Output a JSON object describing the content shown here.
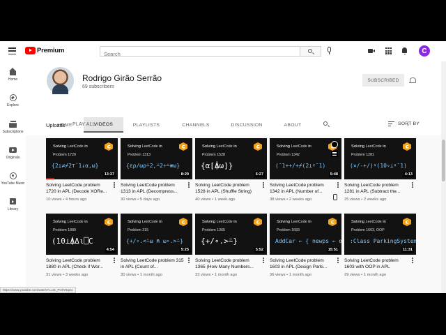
{
  "topbar": {
    "logo_text": "Premium",
    "search_placeholder": "Search",
    "avatar_letter": "C"
  },
  "sidebar": {
    "items": [
      {
        "label": "Home",
        "icon": "home-icon"
      },
      {
        "label": "Explore",
        "icon": "explore-icon"
      },
      {
        "label": "Subscriptions",
        "icon": "subscriptions-icon"
      },
      {
        "label": "Originals",
        "icon": "originals-icon"
      },
      {
        "label": "YouTube Music",
        "icon": "music-icon"
      },
      {
        "label": "Library",
        "icon": "library-icon"
      }
    ]
  },
  "channel": {
    "name": "Rodrigo Girão Serrão",
    "subscribers": "69 subscribers",
    "subscribe_label": "SUBSCRIBED",
    "tabs": [
      "HOME",
      "VIDEOS",
      "PLAYLISTS",
      "CHANNELS",
      "DISCUSSION",
      "ABOUT"
    ],
    "active_tab": "VIDEOS"
  },
  "uploads": {
    "title": "Uploads",
    "play_all": "PLAY ALL",
    "sort_label": "SORT BY"
  },
  "videos": [
    {
      "solving": "Solving",
      "leetcode": "LeetCode",
      "in": "in",
      "problem": "Problem 1720",
      "apl": "{2⊥≠⌿2⊤¨1↓α,ω}",
      "duration": "13:37",
      "title": "Solving LeetCode problem 1720 in APL (Decode XORe...",
      "views": "10 views",
      "age": "4 hours ago",
      "progress": 0.12
    },
    {
      "solving": "Solving",
      "leetcode": "LeetCode",
      "in": "in",
      "problem": "Problem 1313",
      "apl": "{ε⍴/ωρ⍨2,⍨2÷⍨≢ω}",
      "duration": "8:29",
      "title": "Solving LeetCode problem 1313 in APL (Decompress...",
      "views": "30 views",
      "age": "5 days ago"
    },
    {
      "solving": "Solving",
      "leetcode": "LeetCode",
      "in": "in",
      "problem": "Problem 1528",
      "apl": "{α[⍋ω]}",
      "duration": "6:27",
      "title": "Solving LeetCode problem 1528 in APL (Shuffle String)",
      "views": "40 views",
      "age": "1 week ago",
      "big": true
    },
    {
      "solving": "Solving",
      "leetcode": "LeetCode",
      "in": "in",
      "problem": "Problem 1342",
      "apl": "(¯1++/+⌿(2⊥⍣¯1)",
      "duration": "5:48",
      "title": "Solving LeetCode problem 1342 in APL (Number of...",
      "views": "38 views",
      "age": "2 weeks ago",
      "hover": true
    },
    {
      "solving": "Solving",
      "leetcode": "LeetCode",
      "in": "in",
      "problem": "Problem 1281",
      "apl": "(×/-+/)⍣(10∘⊥⍣¯1)",
      "duration": "4:13",
      "title": "Solving LeetCode problem 1281 in APL (Subtract the...",
      "views": "25 views",
      "age": "2 weeks ago"
    },
    {
      "solving": "Solving",
      "leetcode": "LeetCode",
      "in": "in",
      "problem": "Problem 1889",
      "apl": "(10⊥⍋Δι⎕C",
      "duration": "4:54",
      "title": "Solving LeetCode problem 1880 in APL (Check if Wor...",
      "views": "31 views",
      "age": "3 weeks ago",
      "big": true
    },
    {
      "solving": "Solving",
      "leetcode": "LeetCode",
      "in": "in",
      "problem": "Problem 315",
      "apl": "{+/∘.<⍨⍵ ⍝ ⍵∘.>⍨}",
      "duration": "5:25",
      "title": "Solving LeetCode problem 315 in APL (Count of...",
      "views": "30 views",
      "age": "1 month ago"
    },
    {
      "solving": "Solving",
      "leetcode": "LeetCode",
      "in": "in",
      "problem": "Problem 1365",
      "apl": "{+/∘.>⍨}",
      "duration": "5:52",
      "title": "Solving LeetCode problem 1365 (How Many Numbers...",
      "views": "33 views",
      "age": "1 month ago",
      "big": true
    },
    {
      "solving": "Solving",
      "leetcode": "LeetCode",
      "in": "in",
      "problem": "Problem 1683",
      "apl": "AddCar ← {  newps ← ⍺+⍵  }",
      "duration": "15:51",
      "title": "Solving LeetCode problem 1603 in APL (Design Parki...",
      "views": "36 views",
      "age": "1 month ago"
    },
    {
      "solving": "Solving",
      "leetcode": "LeetCode",
      "in": "in",
      "problem": "Problem 1603, OOP",
      "apl": ":Class ParkingSystem",
      "duration": "11:31",
      "title": "Solving LeetCode problem 1603 with OOP in APL",
      "views": "29 views",
      "age": "1 month ago"
    }
  ],
  "status_url": "https://www.youtube.com/watch?v=eE_PV5Y9qUo",
  "colors": {
    "brand": "#ff0000",
    "accent": "#f4a21a",
    "avatar": "#8a2be2"
  }
}
